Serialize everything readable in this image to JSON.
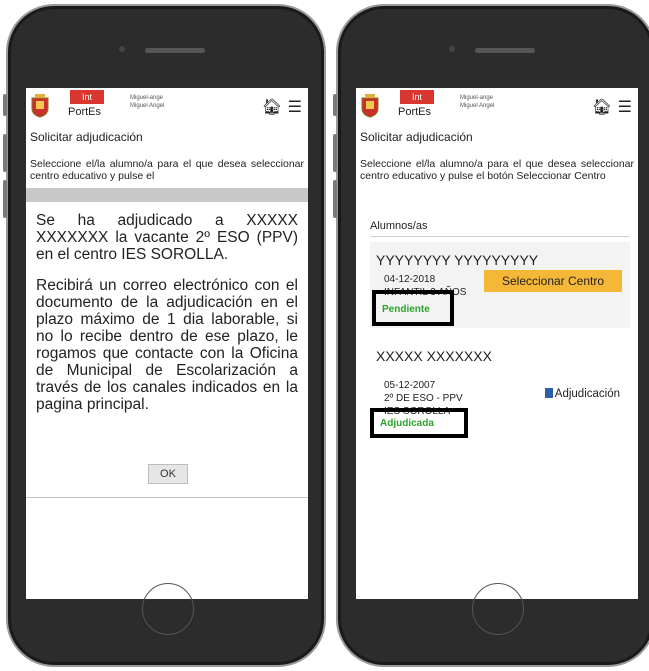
{
  "header": {
    "int_label": "Int",
    "app_name": "PortEs",
    "user_line1": "Miguel-ange",
    "user_line2": "Miguel Angel"
  },
  "page_title": "Solicitar adjudicación",
  "left": {
    "instructions": "Seleccione el/la alumno/a para el que desea seleccionar centro educativo y pulse el",
    "modal": {
      "paragraph1": "Se ha adjudicado a XXXXX XXXXXXX la vacante 2º ESO (PPV) en el centro IES SOROLLA.",
      "paragraph2": "Recibirá un correo electrónico con el documento de la adjudicación en el plazo máximo de 1 dia laborable, si no lo recibe dentro de ese plazo, le rogamos que contacte con la Oficina de Municipal de Escolarización a través de los canales indicados en la pagina principal.",
      "ok_label": "OK"
    }
  },
  "right": {
    "instructions": "Seleccione el/la alumno/a para el que desea seleccionar centro educativo y pulse el botón Seleccionar Centro",
    "section_label": "Alumnos/as",
    "students": [
      {
        "name": "YYYYYYYY YYYYYYYYY",
        "birth_date": "04-12-2018",
        "course": "INFANTIL 3 AÑOS",
        "button_label": "Seleccionar Centro",
        "status": "Pendiente"
      },
      {
        "name": "XXXXX XXXXXXX",
        "birth_date": "05-12-2007",
        "course": "2º DE ESO - PPV",
        "school": "IES SOROLLA",
        "link_label": "Adjudicación",
        "status": "Adjudicada"
      }
    ]
  },
  "colors": {
    "int_badge": "#d8362e",
    "select_button": "#f5b738",
    "status_green": "#2aa52a",
    "phone_body": "#2c2c2c"
  }
}
